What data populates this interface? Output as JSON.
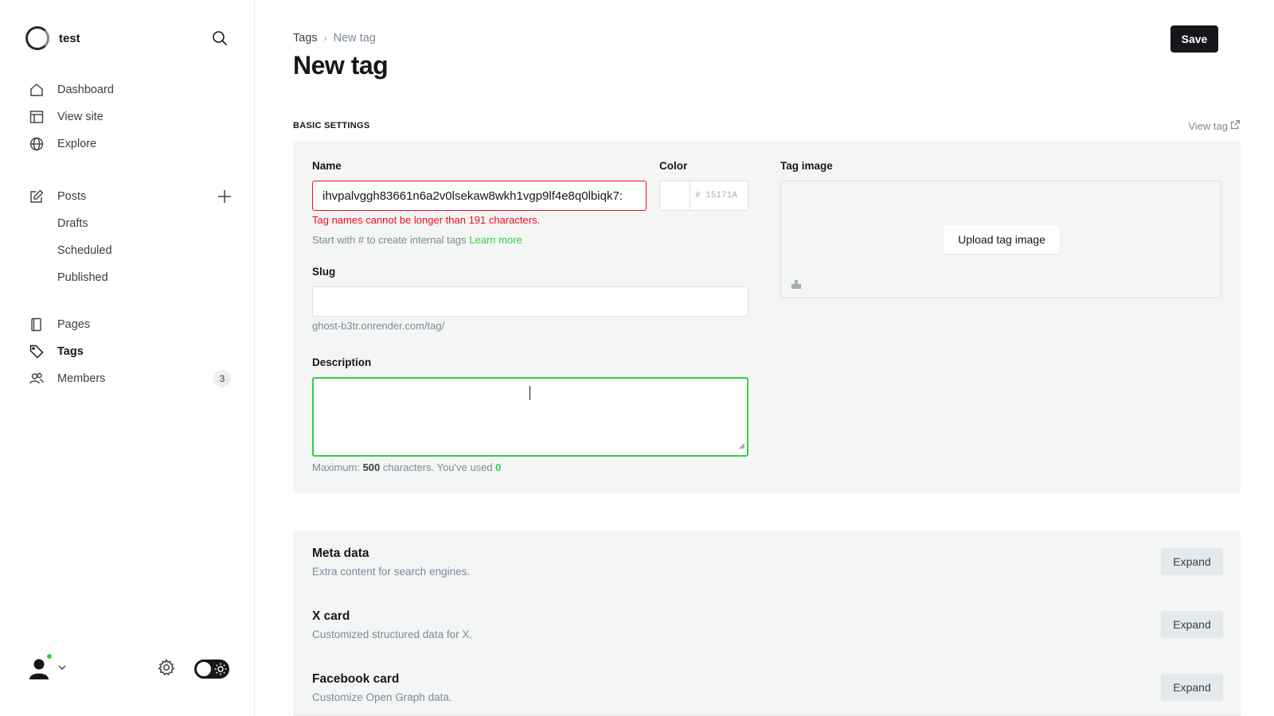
{
  "sidebar": {
    "site_name": "test",
    "nav": [
      {
        "label": "Dashboard",
        "icon": "home-icon"
      },
      {
        "label": "View site",
        "icon": "layout-icon"
      },
      {
        "label": "Explore",
        "icon": "globe-icon"
      }
    ],
    "posts": {
      "label": "Posts",
      "sub": [
        "Drafts",
        "Scheduled",
        "Published"
      ]
    },
    "pages": {
      "label": "Pages"
    },
    "tags": {
      "label": "Tags"
    },
    "members": {
      "label": "Members",
      "count": "3"
    }
  },
  "header": {
    "breadcrumb_parent": "Tags",
    "breadcrumb_separator": "›",
    "breadcrumb_current": "New tag",
    "title": "New tag",
    "save_label": "Save"
  },
  "basic": {
    "section_title": "BASIC SETTINGS",
    "view_tag": "View tag",
    "name_label": "Name",
    "name_value": "ihvpalvggh83661n6a2v0lsekaw8wkh1vgp9lf4e8q0lbiqk7:",
    "name_error": "Tag names cannot be longer than 191 characters.",
    "name_hint": "Start with # to create internal tags",
    "learn_more": "Learn more",
    "color_label": "Color",
    "color_value": "# 15171A",
    "slug_label": "Slug",
    "slug_value": "",
    "slug_url": "ghost-b3tr.onrender.com/tag/",
    "description_label": "Description",
    "desc_counter_prefix": "Maximum:",
    "desc_max": "500",
    "desc_counter_mid": "characters. You've used",
    "desc_used": "0",
    "tag_image_label": "Tag image",
    "upload_label": "Upload tag image"
  },
  "sections": [
    {
      "title": "Meta data",
      "desc": "Extra content for search engines.",
      "button": "Expand"
    },
    {
      "title": "X card",
      "desc": "Customized structured data for X.",
      "button": "Expand"
    },
    {
      "title": "Facebook card",
      "desc": "Customize Open Graph data.",
      "button": "Expand"
    }
  ],
  "colors": {
    "accent": "#30cf43",
    "error": "#f50b23",
    "dark": "#15171a"
  }
}
